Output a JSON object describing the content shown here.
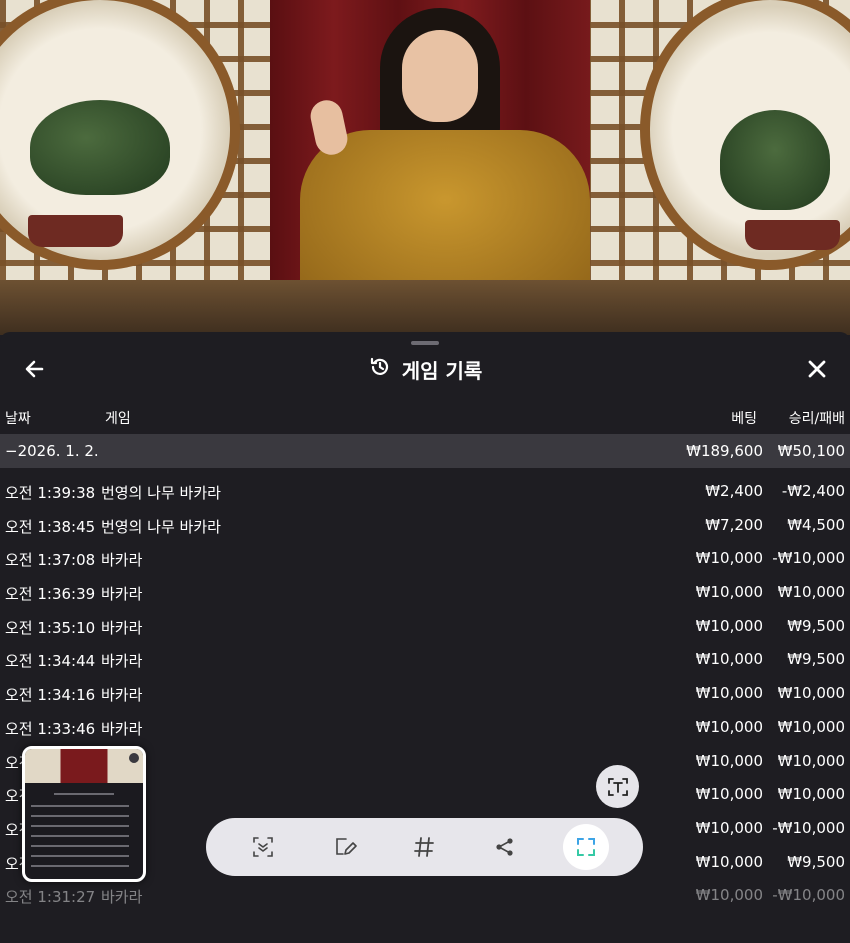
{
  "header": {
    "title": "게임 기록",
    "back_icon": "arrow-left-icon",
    "history_icon": "history-icon",
    "close_icon": "close-icon"
  },
  "columns": {
    "date": "날짜",
    "game": "게임",
    "bet": "베팅",
    "win_loss": "승리/패배"
  },
  "summary": {
    "date": "−2026. 1. 2.",
    "bet": "₩189,600",
    "win_loss": "₩50,100"
  },
  "rows": [
    {
      "time": "오전 1:39:38",
      "game": "번영의 나무 바카라",
      "bet": "₩2,400",
      "win_loss": "-₩2,400"
    },
    {
      "time": "오전 1:38:45",
      "game": "번영의 나무 바카라",
      "bet": "₩7,200",
      "win_loss": "₩4,500"
    },
    {
      "time": "오전 1:37:08",
      "game": "바카라",
      "bet": "₩10,000",
      "win_loss": "-₩10,000"
    },
    {
      "time": "오전 1:36:39",
      "game": "바카라",
      "bet": "₩10,000",
      "win_loss": "₩10,000"
    },
    {
      "time": "오전 1:35:10",
      "game": "바카라",
      "bet": "₩10,000",
      "win_loss": "₩9,500"
    },
    {
      "time": "오전 1:34:44",
      "game": "바카라",
      "bet": "₩10,000",
      "win_loss": "₩9,500"
    },
    {
      "time": "오전 1:34:16",
      "game": "바카라",
      "bet": "₩10,000",
      "win_loss": "₩10,000"
    },
    {
      "time": "오전 1:33:46",
      "game": "바카라",
      "bet": "₩10,000",
      "win_loss": "₩10,000"
    },
    {
      "time": "오전",
      "game": "",
      "bet": "₩10,000",
      "win_loss": "₩10,000"
    },
    {
      "time": "오전",
      "game": "",
      "bet": "₩10,000",
      "win_loss": "₩10,000"
    },
    {
      "time": "오전",
      "game": "",
      "bet": "₩10,000",
      "win_loss": "-₩10,000"
    },
    {
      "time": "오전",
      "game": "",
      "bet": "₩10,000",
      "win_loss": "₩9,500"
    },
    {
      "time": "오전 1:31:27",
      "game": "바카라",
      "bet": "₩10,000",
      "win_loss": "-₩10,000"
    }
  ],
  "toolbar": {
    "icons": [
      "smart-select-icon",
      "draw-edit-icon",
      "hashtag-icon",
      "share-icon",
      "capture-frame-icon"
    ],
    "ocr_icon": "text-extract-icon"
  },
  "colors": {
    "background": "#1e1d22",
    "summary_row": "#3a393f",
    "toolbar": "#e7e6eb"
  }
}
